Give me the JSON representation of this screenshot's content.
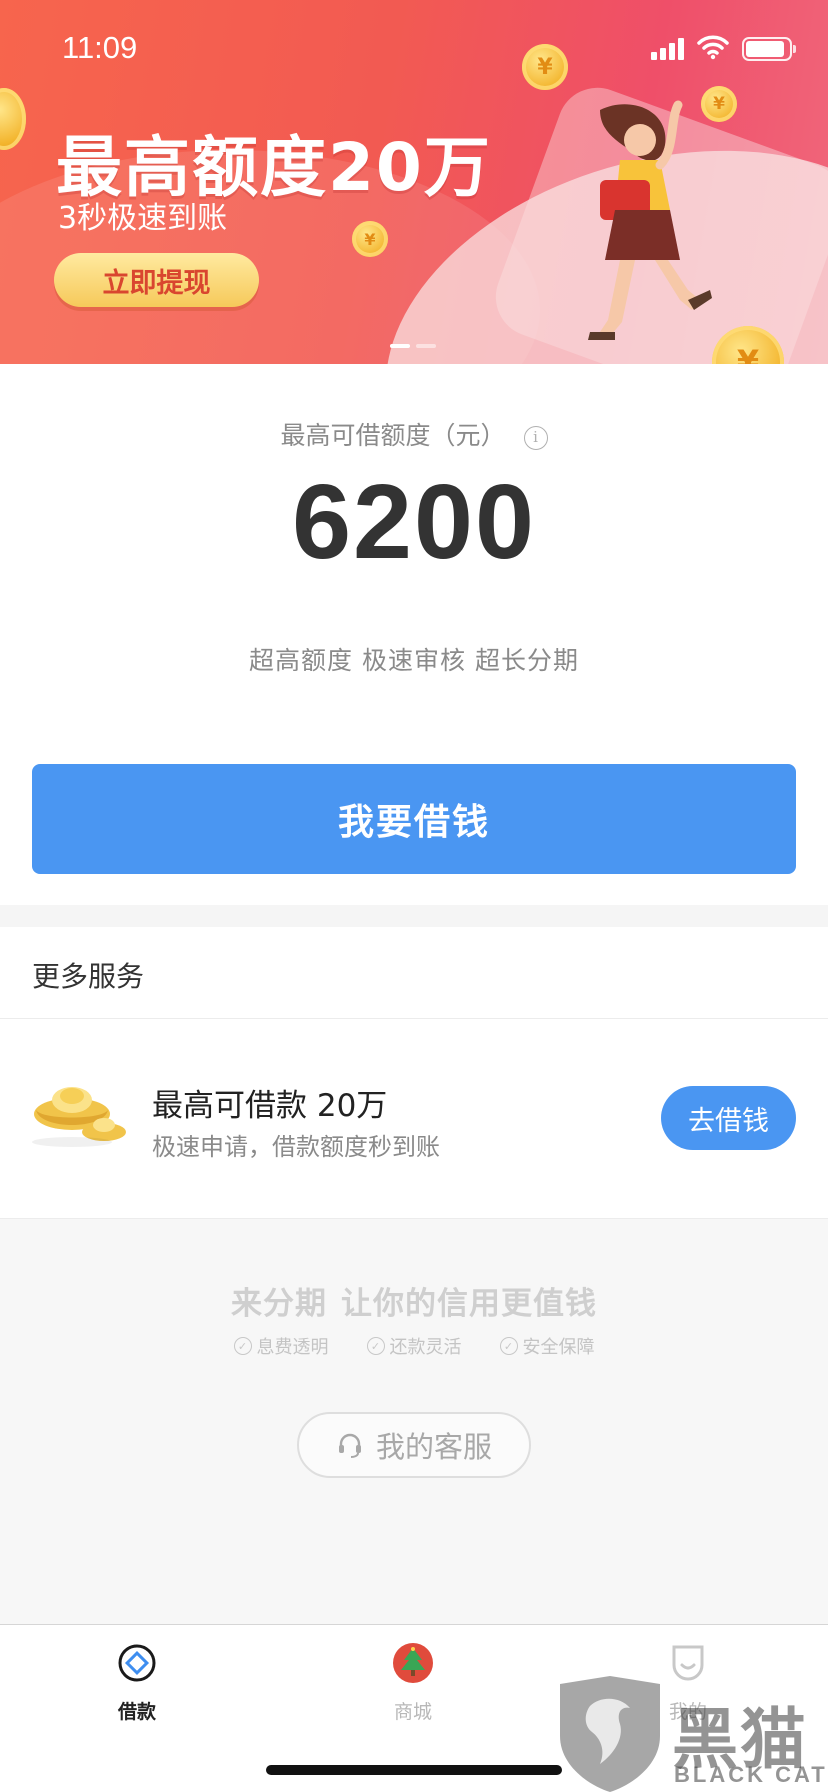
{
  "status_bar": {
    "time": "11:09"
  },
  "banner": {
    "title": "最高额度20万",
    "subtitle": "3秒极速到账",
    "cta_label": "立即提现",
    "coin_symbol": "¥",
    "slide_count": 2,
    "active_slide": 1
  },
  "credit": {
    "label": "最高可借额度（元）",
    "info_symbol": "i",
    "amount": "6200",
    "tagline": "超高额度 极速审核 超长分期",
    "button_label": "我要借钱"
  },
  "services": {
    "section_title": "更多服务",
    "item": {
      "title": "最高可借款 20万",
      "description": "极速申请，借款额度秒到账",
      "button_label": "去借钱"
    }
  },
  "footer": {
    "slogan_brand": "来分期",
    "slogan_text": "让你的信用更值钱",
    "features": [
      "息费透明",
      "还款灵活",
      "安全保障"
    ],
    "check_symbol": "✓",
    "support_label": "我的客服"
  },
  "tab_bar": {
    "tabs": [
      {
        "label": "借款",
        "icon": "loan-icon",
        "active": true
      },
      {
        "label": "商城",
        "icon": "christmas-tree-icon",
        "active": false
      },
      {
        "label": "我的",
        "icon": "profile-icon",
        "active": false
      }
    ]
  },
  "watermark": {
    "text": "黑猫",
    "sub": "BLACK CAT"
  },
  "colors": {
    "primary": "#4a96f2",
    "banner_red": "#f25a52",
    "gold": "#f3b52e"
  }
}
